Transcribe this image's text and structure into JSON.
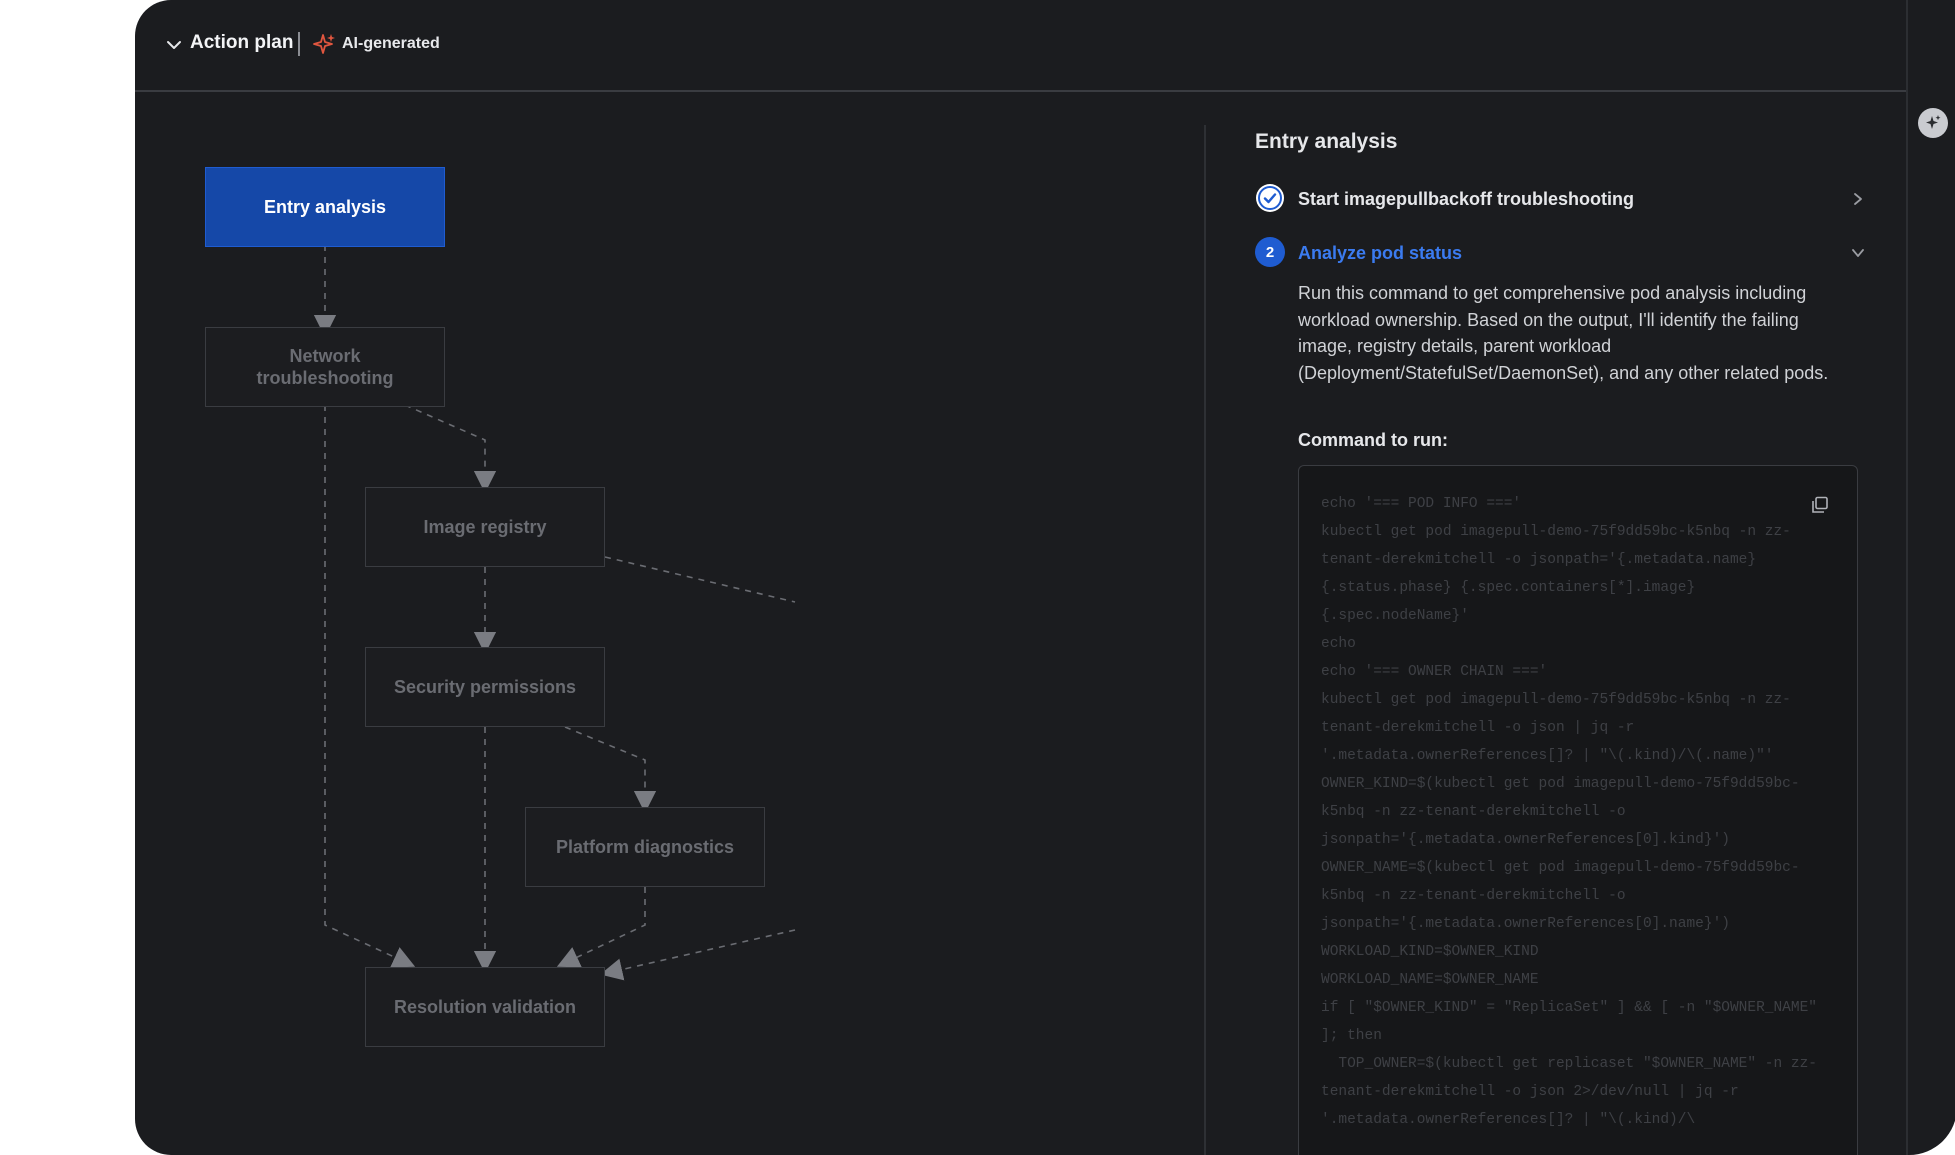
{
  "header": {
    "title": "Action plan",
    "ai_badge": "AI-generated"
  },
  "flow": {
    "nodes": [
      {
        "id": "entry",
        "label": "Entry analysis",
        "state": "active"
      },
      {
        "id": "network",
        "label": "Network troubleshooting",
        "state": "inactive"
      },
      {
        "id": "image",
        "label": "Image registry",
        "state": "inactive"
      },
      {
        "id": "security",
        "label": "Security permissions",
        "state": "inactive"
      },
      {
        "id": "platform",
        "label": "Platform diagnostics",
        "state": "inactive"
      },
      {
        "id": "resolution",
        "label": "Resolution validation",
        "state": "inactive"
      }
    ]
  },
  "panel": {
    "title": "Entry analysis",
    "steps": [
      {
        "label": "Start imagepullbackoff troubleshooting",
        "status": "done"
      },
      {
        "number": "2",
        "label": "Analyze pod status",
        "status": "current"
      }
    ],
    "description": "Run this command to get comprehensive pod analysis including workload ownership. Based on the output, I'll identify the failing image, registry details, parent workload (Deployment/StatefulSet/DaemonSet), and any other related pods.",
    "command_label": "Command to run:",
    "command": "echo '=== POD INFO ==='\nkubectl get pod imagepull-demo-75f9dd59bc-k5nbq -n zz-tenant-derekmitchell -o jsonpath='{.metadata.name} {.status.phase} {.spec.containers[*].image} {.spec.nodeName}'\necho\necho '=== OWNER CHAIN ==='\nkubectl get pod imagepull-demo-75f9dd59bc-k5nbq -n zz-tenant-derekmitchell -o json | jq -r '.metadata.ownerReferences[]? | \"\\(.kind)/\\(.name)\"'\nOWNER_KIND=$(kubectl get pod imagepull-demo-75f9dd59bc-k5nbq -n zz-tenant-derekmitchell -o jsonpath='{.metadata.ownerReferences[0].kind}')\nOWNER_NAME=$(kubectl get pod imagepull-demo-75f9dd59bc-k5nbq -n zz-tenant-derekmitchell -o jsonpath='{.metadata.ownerReferences[0].name}')\nWORKLOAD_KIND=$OWNER_KIND\nWORKLOAD_NAME=$OWNER_NAME\nif [ \"$OWNER_KIND\" = \"ReplicaSet\" ] && [ -n \"$OWNER_NAME\" ]; then\n  TOP_OWNER=$(kubectl get replicaset \"$OWNER_NAME\" -n zz-tenant-derekmitchell -o json 2>/dev/null | jq -r '.metadata.ownerReferences[]? | \"\\(.kind)/\\"
  },
  "colors": {
    "accent": "#1f5cd1",
    "accent_text": "#3b7bf0",
    "background": "#1b1c1f",
    "ai_spark": "#e0563f"
  }
}
